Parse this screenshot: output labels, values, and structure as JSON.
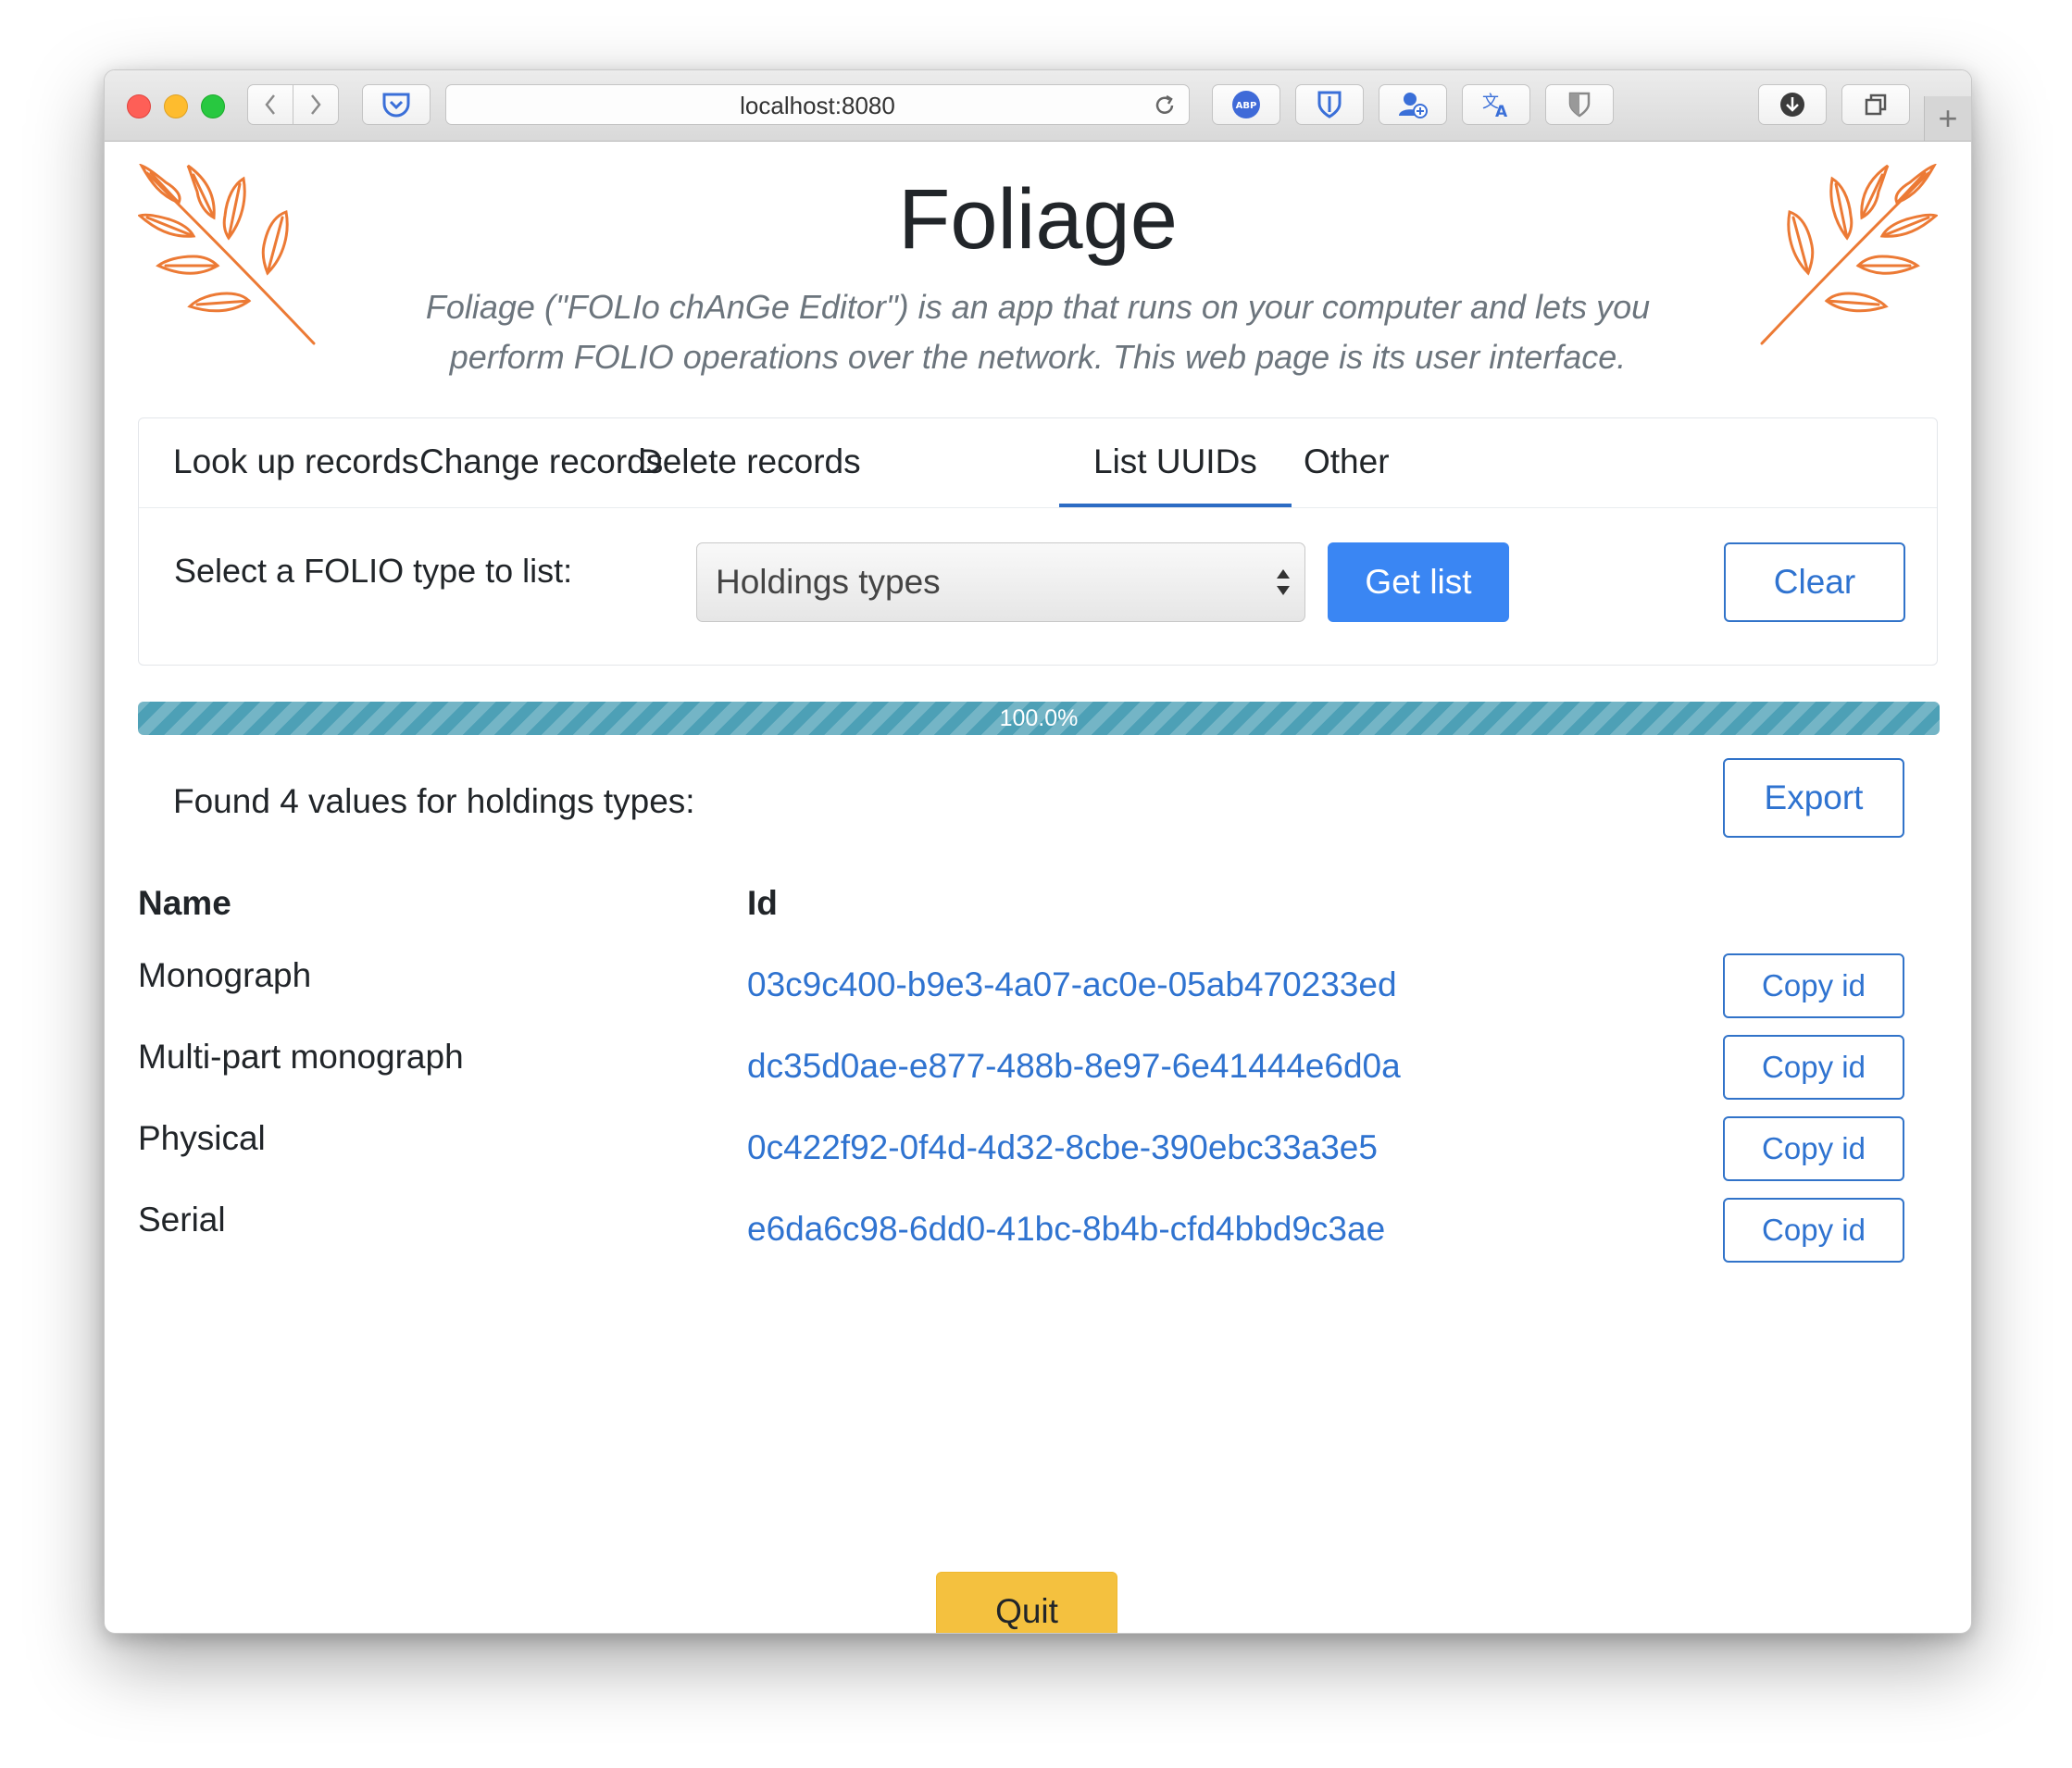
{
  "browser": {
    "url": "localhost:8080"
  },
  "app": {
    "title": "Foliage",
    "description": "Foliage (\"FOLIo chAnGe Editor\") is an app that runs on your computer and lets you perform FOLIO operations over the network. This web page is its user interface."
  },
  "tabs": [
    {
      "label": "Look up records"
    },
    {
      "label": "Change records"
    },
    {
      "label": "Delete records"
    },
    {
      "label": "List UUIDs",
      "active": true
    },
    {
      "label": "Other"
    }
  ],
  "list_panel": {
    "select_label": "Select a FOLIO type to list:",
    "selected_type": "Holdings types",
    "get_list_label": "Get list",
    "clear_label": "Clear"
  },
  "progress": {
    "value": 1.0,
    "label": "100.0%",
    "color": "#4da0b6"
  },
  "results": {
    "summary": "Found 4 values for holdings types:",
    "export_label": "Export",
    "columns": [
      "Name",
      "Id"
    ],
    "rows": [
      {
        "name": "Monograph",
        "id": "03c9c400-b9e3-4a07-ac0e-05ab470233ed",
        "copy_label": "Copy id"
      },
      {
        "name": "Multi-part monograph",
        "id": "dc35d0ae-e877-488b-8e97-6e41444e6d0a",
        "copy_label": "Copy id"
      },
      {
        "name": "Physical",
        "id": "0c422f92-0f4d-4d32-8cbe-390ebc33a3e5",
        "copy_label": "Copy id"
      },
      {
        "name": "Serial",
        "id": "e6da6c98-6dd0-41bc-8b4b-cfd4bbd9c3ae",
        "copy_label": "Copy id"
      }
    ]
  },
  "quit_label": "Quit",
  "colors": {
    "primary": "#3a86f3",
    "link": "#2f73d0",
    "warning": "#f4c13f",
    "leaf": "#ec7a35"
  },
  "icons": {
    "toolbar": [
      "back-icon",
      "forward-icon",
      "pocket-icon",
      "reload-icon",
      "adblock-icon",
      "bitwarden-icon",
      "user-add-icon",
      "translate-icon",
      "privacy-shield-icon",
      "download-icon",
      "tabs-overview-icon",
      "new-tab-icon"
    ],
    "decoration": [
      "leaf-branch-icon"
    ]
  }
}
